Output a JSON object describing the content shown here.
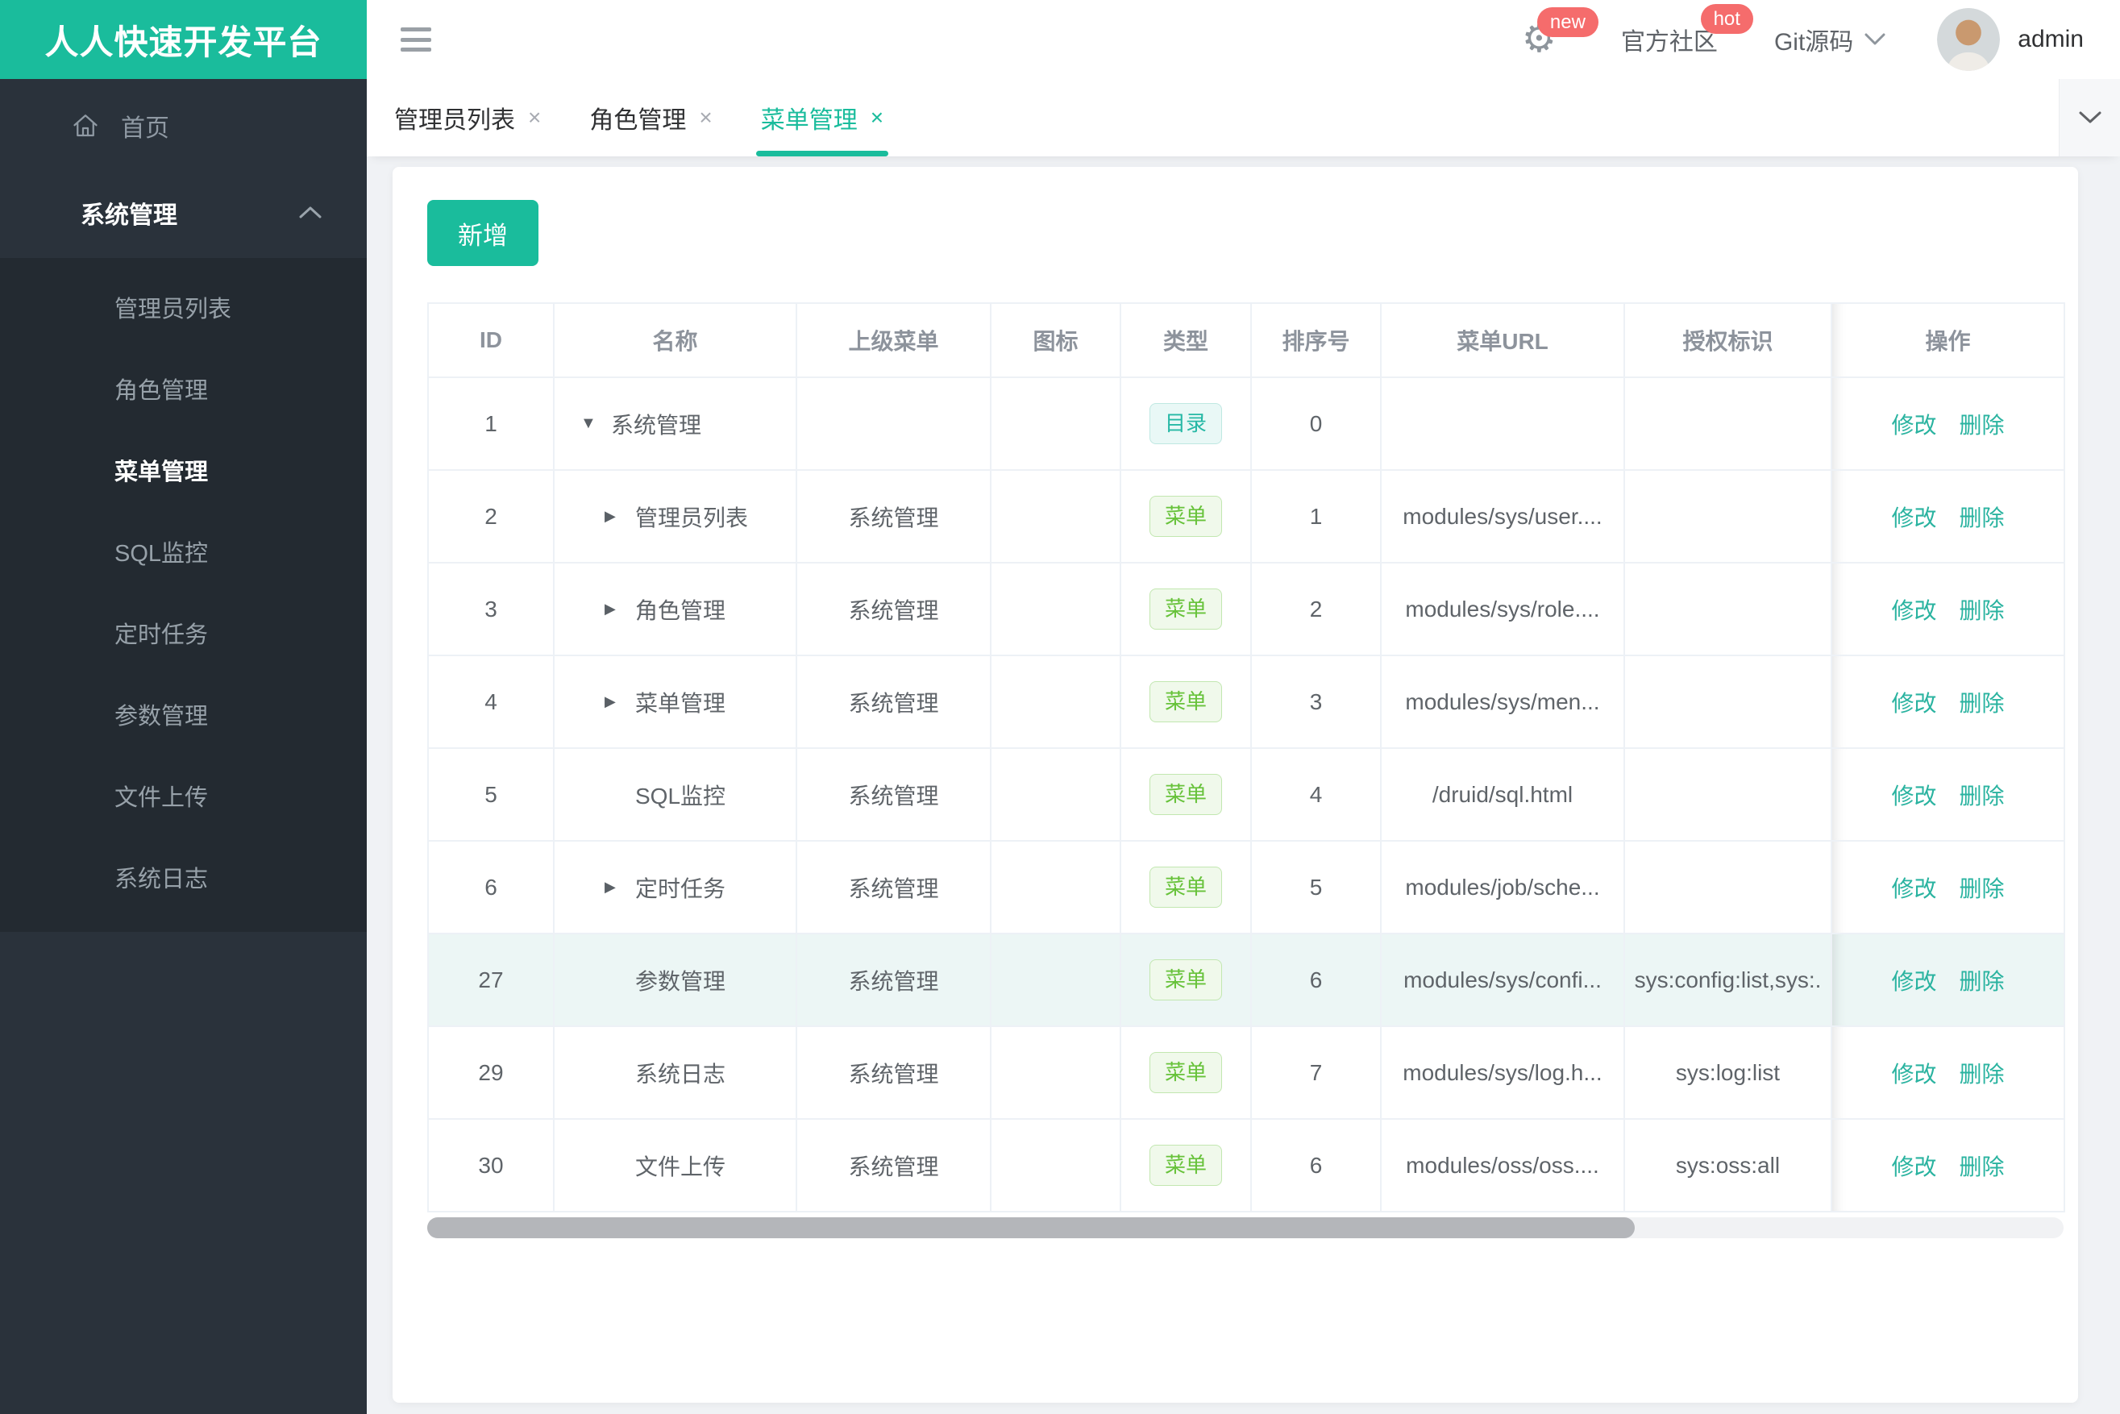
{
  "theme": {
    "primary": "#1abc9c",
    "sidebar_bg": "#2a323b",
    "submenu_bg": "#232a31",
    "badge_red": "#f56c6c",
    "hover_row_bg": "#ecf6f5",
    "tag_dir_color": "#26b8a5",
    "tag_menu_color": "#67c23a"
  },
  "topbar": {
    "logo": "人人快速开发平台",
    "gear_badge": "new",
    "community_label": "官方社区",
    "community_badge": "hot",
    "git_label": "Git源码",
    "username": "admin"
  },
  "sidebar": {
    "home_label": "首页",
    "section_label": "系统管理",
    "items": [
      "管理员列表",
      "角色管理",
      "菜单管理",
      "SQL监控",
      "定时任务",
      "参数管理",
      "文件上传",
      "系统日志"
    ],
    "active_item": "菜单管理"
  },
  "tabs": {
    "close_glyph": "×",
    "items": [
      {
        "label": "管理员列表",
        "active": false
      },
      {
        "label": "角色管理",
        "active": false
      },
      {
        "label": "菜单管理",
        "active": true
      }
    ]
  },
  "toolbar": {
    "add_label": "新增"
  },
  "table": {
    "columns": [
      "ID",
      "名称",
      "上级菜单",
      "图标",
      "类型",
      "排序号",
      "菜单URL",
      "授权标识",
      "操作"
    ],
    "type_labels": {
      "dir": "目录",
      "menu": "菜单"
    },
    "actions": {
      "edit": "修改",
      "delete": "删除"
    },
    "rows": [
      {
        "id": "1",
        "name": "系统管理",
        "caret": "down",
        "indent": 0,
        "parent": "",
        "type": "dir",
        "order": "0",
        "url": "",
        "auth": "",
        "highlight": false
      },
      {
        "id": "2",
        "name": "管理员列表",
        "caret": "right",
        "indent": 1,
        "parent": "系统管理",
        "type": "menu",
        "order": "1",
        "url": "modules/sys/user....",
        "auth": "",
        "highlight": false
      },
      {
        "id": "3",
        "name": "角色管理",
        "caret": "right",
        "indent": 1,
        "parent": "系统管理",
        "type": "menu",
        "order": "2",
        "url": "modules/sys/role....",
        "auth": "",
        "highlight": false
      },
      {
        "id": "4",
        "name": "菜单管理",
        "caret": "right",
        "indent": 1,
        "parent": "系统管理",
        "type": "menu",
        "order": "3",
        "url": "modules/sys/men...",
        "auth": "",
        "highlight": false
      },
      {
        "id": "5",
        "name": "SQL监控",
        "caret": "none",
        "indent": 1,
        "parent": "系统管理",
        "type": "menu",
        "order": "4",
        "url": "/druid/sql.html",
        "auth": "",
        "highlight": false
      },
      {
        "id": "6",
        "name": "定时任务",
        "caret": "right",
        "indent": 1,
        "parent": "系统管理",
        "type": "menu",
        "order": "5",
        "url": "modules/job/sche...",
        "auth": "",
        "highlight": false
      },
      {
        "id": "27",
        "name": "参数管理",
        "caret": "none",
        "indent": 1,
        "parent": "系统管理",
        "type": "menu",
        "order": "6",
        "url": "modules/sys/confi...",
        "auth": "sys:config:list,sys:.",
        "highlight": true
      },
      {
        "id": "29",
        "name": "系统日志",
        "caret": "none",
        "indent": 1,
        "parent": "系统管理",
        "type": "menu",
        "order": "7",
        "url": "modules/sys/log.h...",
        "auth": "sys:log:list",
        "highlight": false
      },
      {
        "id": "30",
        "name": "文件上传",
        "caret": "none",
        "indent": 1,
        "parent": "系统管理",
        "type": "menu",
        "order": "6",
        "url": "modules/oss/oss....",
        "auth": "sys:oss:all",
        "highlight": false
      }
    ]
  }
}
